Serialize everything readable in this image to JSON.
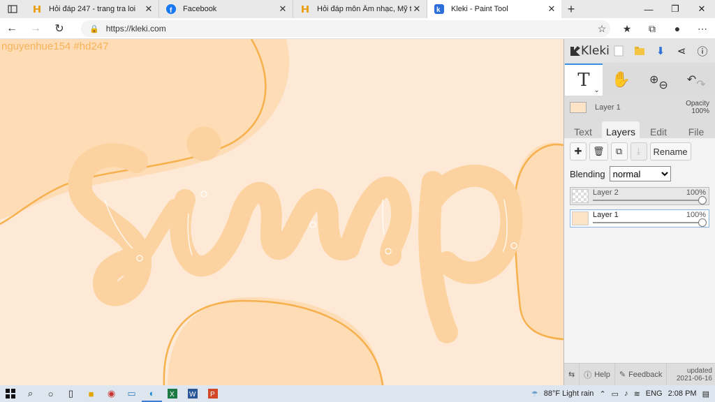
{
  "browser": {
    "tabs": [
      {
        "title": "Hỏi đáp 247 - trang tra loi",
        "icon": "hoidap-favicon"
      },
      {
        "title": "Facebook",
        "icon": "facebook-favicon"
      },
      {
        "title": "Hỏi đáp môn Âm nhạc, Mỹ thuật",
        "icon": "hoidap-favicon"
      },
      {
        "title": "Kleki - Paint Tool",
        "icon": "kleki-favicon",
        "active": true
      }
    ],
    "url": "https://kleki.com"
  },
  "canvas": {
    "watermark": "nguyenhue154 #hd247",
    "lettering": "simp",
    "colors": {
      "background": "#fde9d5",
      "blob": "#fcd9b0",
      "outline": "#f6b04c",
      "letters": "#fdd4a2"
    }
  },
  "panel": {
    "brand": "Kleki",
    "current_layer": "Layer 1",
    "opacity_label": "Opacity",
    "opacity_value": "100%",
    "tabs": [
      "Text",
      "Layers",
      "Edit",
      "File"
    ],
    "rename_label": "Rename",
    "blending_label": "Blending",
    "blending_value": "normal",
    "layers": [
      {
        "name": "Layer 2",
        "opacity": "100%"
      },
      {
        "name": "Layer 1",
        "opacity": "100%"
      }
    ],
    "help_label": "Help",
    "feedback_label": "Feedback",
    "updated_label": "updated",
    "updated_date": "2021-06-16"
  },
  "taskbar": {
    "weather": "88°F  Light rain",
    "lang": "ENG",
    "time": "2:08 PM"
  }
}
